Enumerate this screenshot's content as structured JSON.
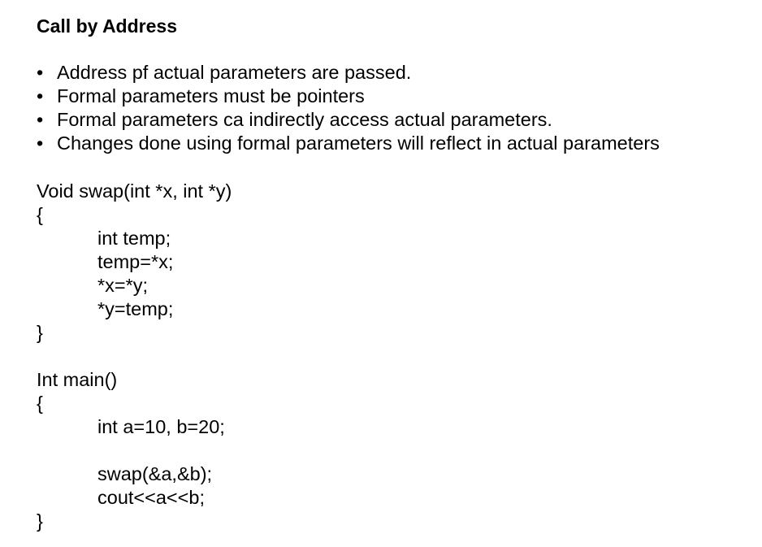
{
  "slide": {
    "title": "Call by Address",
    "bullets": [
      "Address pf actual parameters are passed.",
      "Formal parameters must be pointers",
      "Formal parameters ca indirectly access actual parameters.",
      "Changes done using formal parameters will reflect in actual parameters"
    ],
    "bullet_glyph": "•"
  },
  "code": {
    "swap_signature": "Void swap(int *x, int *y)",
    "swap_open": "{",
    "swap_body": [
      "int temp;",
      "temp=*x;",
      "*x=*y;",
      "*y=temp;"
    ],
    "swap_close": "}",
    "main_signature": "Int main()",
    "main_open": "{",
    "main_body_1": "int a=10, b=20;",
    "main_body_2": [
      "swap(&a,&b);",
      "cout<<a<<b;"
    ],
    "main_close": "}"
  }
}
